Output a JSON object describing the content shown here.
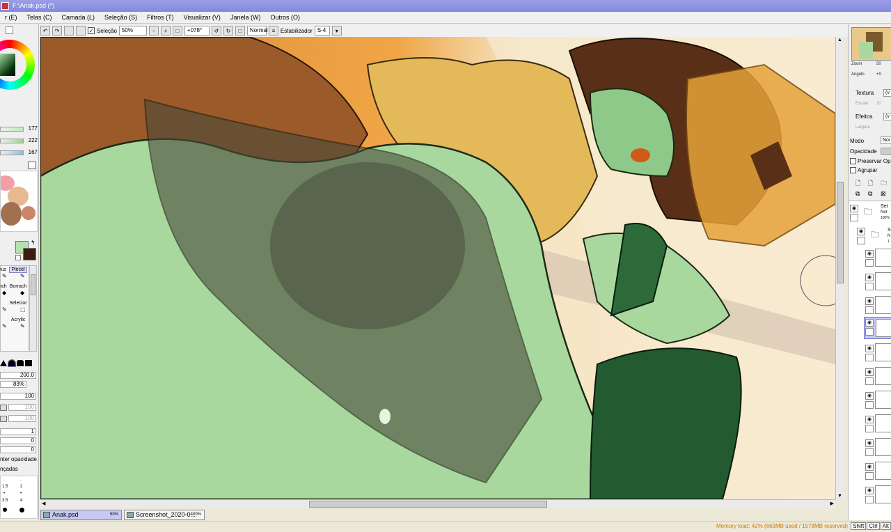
{
  "window": {
    "title": "F:\\Anak.psd (*)"
  },
  "menu": [
    "r (E)",
    "Telas (C)",
    "Camada (L)",
    "Seleção (S)",
    "Filtros (T)",
    "Visualizar (V)",
    "Janela (W)",
    "Outros (O)"
  ],
  "toolbar": {
    "selection_label": "Seleção",
    "zoom_value": "50%",
    "angle_value": "+078°",
    "blend_value": "Normal",
    "stabilizer_label": "Estabilizador",
    "stabilizer_value": "S-4"
  },
  "color": {
    "hsv_values": [
      "177",
      "222",
      "167"
    ],
    "primary": "#b6e1ae",
    "secondary": "#3a1d0f"
  },
  "tools": [
    {
      "label": "rus",
      "name": "brush-tool"
    },
    {
      "label": "Pincel",
      "name": "pincel-tool"
    },
    {
      "label": "nch",
      "name": "smudge-tool"
    },
    {
      "label": "Borrach",
      "name": "eraser-tool"
    },
    {
      "label": "Selecior",
      "name": "selection-tool"
    },
    {
      "label": "Acrylic",
      "name": "acrylic-tool"
    }
  ],
  "brush": {
    "size": "200.0",
    "density": "83%",
    "val_100a": "100",
    "val_100b": "100",
    "val_100c": "100",
    "val_1": "1",
    "val_0a": "0",
    "val_0b": "0",
    "opacity_label": "nter opacidade",
    "advanced_label": "nçadas",
    "tip_sizes": [
      "1.5",
      "2",
      "3.5",
      "4"
    ]
  },
  "right": {
    "zoom_label": "Zoom",
    "zoom_value": "50",
    "angle_label": "Angulo",
    "angle_value": "+0",
    "texture_label": "Textura",
    "texture_value": "(v",
    "scale_label": "Escala",
    "scale_value": "10",
    "effects_label": "Efeitos",
    "effects_value": "(v",
    "width_label": "Largura",
    "mode_label": "Modo",
    "mode_value": "Nor",
    "opacity_label": "Opacidade",
    "preserve_label": "Preservar Opa",
    "group_label": "Agrupar",
    "layers": [
      {
        "name": "Set",
        "sub": "Nor",
        "pct": "100%"
      },
      {
        "name": "S",
        "sub": "N",
        "pct": "1"
      }
    ]
  },
  "tabs": [
    {
      "name": "Anak.psd",
      "zoom": "50%"
    },
    {
      "name": "Screenshot_2020-0...",
      "zoom": "400%"
    }
  ],
  "status": {
    "memory": "Memory load: 42% (669MB used / 1578MB reserved)",
    "keys": [
      "Shift",
      "Ctrl",
      "Alt"
    ]
  }
}
